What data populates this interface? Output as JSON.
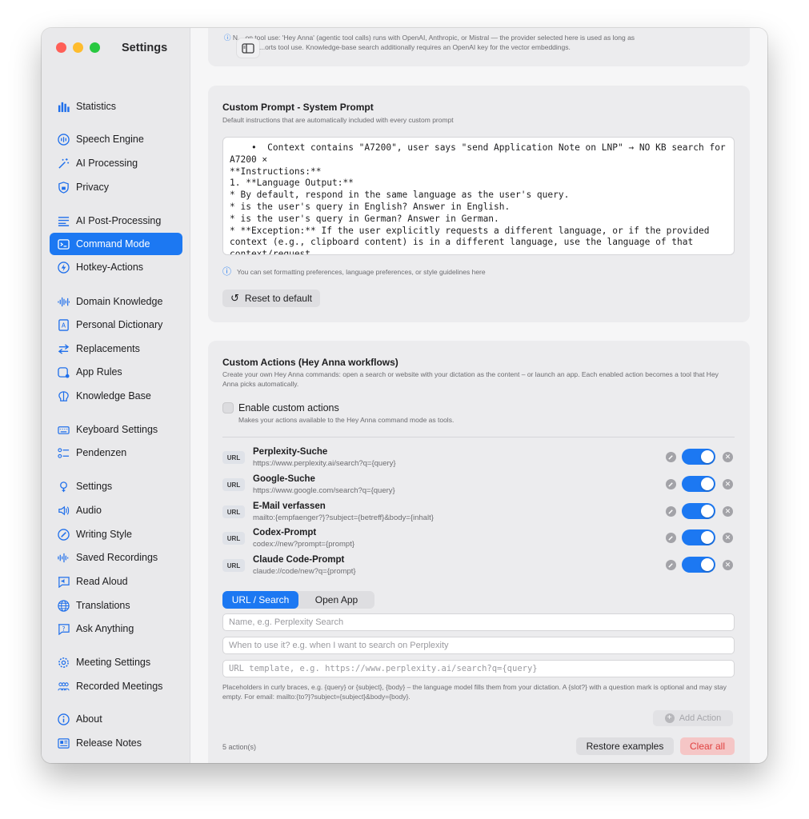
{
  "window": {
    "title": "Settings",
    "traffic_colors": [
      "#ff5f57",
      "#febc2e",
      "#28c840"
    ]
  },
  "sidebar": {
    "items": [
      {
        "label": "Statistics",
        "icon": "bar-chart-icon"
      },
      {
        "label": "Speech Engine",
        "icon": "waveform-circle-icon"
      },
      {
        "label": "AI Processing",
        "icon": "magic-wand-icon"
      },
      {
        "label": "Privacy",
        "icon": "lock-shield-icon"
      },
      {
        "label": "AI Post-Processing",
        "icon": "list-lines-icon"
      },
      {
        "label": "Command Mode",
        "icon": "terminal-icon"
      },
      {
        "label": "Hotkey-Actions",
        "icon": "bolt-circle-icon"
      },
      {
        "label": "Domain Knowledge",
        "icon": "waveform-icon"
      },
      {
        "label": "Personal Dictionary",
        "icon": "dictionary-icon"
      },
      {
        "label": "Replacements",
        "icon": "swap-arrows-icon"
      },
      {
        "label": "App Rules",
        "icon": "app-window-icon"
      },
      {
        "label": "Knowledge Base",
        "icon": "brain-icon"
      },
      {
        "label": "Keyboard Settings",
        "icon": "keyboard-icon"
      },
      {
        "label": "Pendenzen",
        "icon": "checklist-icon"
      },
      {
        "label": "Settings",
        "icon": "gear-icon"
      },
      {
        "label": "Audio",
        "icon": "speaker-icon"
      },
      {
        "label": "Writing Style",
        "icon": "pen-circle-icon"
      },
      {
        "label": "Saved Recordings",
        "icon": "recordings-icon"
      },
      {
        "label": "Read Aloud",
        "icon": "read-aloud-icon"
      },
      {
        "label": "Translations",
        "icon": "globe-icon"
      },
      {
        "label": "Ask Anything",
        "icon": "question-bubble-icon"
      },
      {
        "label": "Meeting Settings",
        "icon": "gear-small-icon"
      },
      {
        "label": "Recorded Meetings",
        "icon": "people-icon"
      },
      {
        "label": "About",
        "icon": "info-icon"
      },
      {
        "label": "Release Notes",
        "icon": "newspaper-icon"
      }
    ],
    "active": "Command Mode"
  },
  "top_info": {
    "line1": "N... on tool use: 'Hey Anna' (agentic tool calls) runs with OpenAI, Anthropic, or Mistral — the provider selected here is used as long as",
    "line2": "...orts tool use. Knowledge-base search additionally requires an OpenAI key for the vector embeddings."
  },
  "custom_prompt": {
    "title": "Custom Prompt - System Prompt",
    "subtitle": "Default instructions that are automatically included with every custom prompt",
    "text": "    •  Context contains \"A7200\", user says \"send Application Note on LNP\" → NO KB search for A7200 ×\n**Instructions:**\n1. **Language Output:**\n* By default, respond in the same language as the user's query.\n* is the user's query in English? Answer in English.\n* is the user's query in German? Answer in German.\n* **Exception:** If the user explicitly requests a different language, or if the provided context (e.g., clipboard content) is in a different language, use the language of that context/request.",
    "hint": "You can set formatting preferences, language preferences, or style guidelines here",
    "reset_label": "Reset to default"
  },
  "custom_actions": {
    "title": "Custom Actions (Hey Anna workflows)",
    "subtitle": "Create your own Hey Anna commands: open a search or website with your dictation as the content – or launch an app. Each enabled action becomes a tool that Hey Anna picks automatically.",
    "enable_label": "Enable custom actions",
    "enable_desc": "Makes your actions available to the Hey Anna command mode as tools.",
    "enabled": false,
    "badge": "URL",
    "actions": [
      {
        "name": "Perplexity-Suche",
        "url": "https://www.perplexity.ai/search?q={query}",
        "enabled": true
      },
      {
        "name": "Google-Suche",
        "url": "https://www.google.com/search?q={query}",
        "enabled": true
      },
      {
        "name": "E-Mail verfassen",
        "url": "mailto:{empfaenger?}?subject={betreff}&body={inhalt}",
        "enabled": true
      },
      {
        "name": "Codex-Prompt",
        "url": "codex://new?prompt={prompt}",
        "enabled": true
      },
      {
        "name": "Claude Code-Prompt",
        "url": "claude://code/new?q={prompt}",
        "enabled": true
      }
    ],
    "tabs": [
      "URL / Search",
      "Open App"
    ],
    "active_tab": "URL / Search",
    "name_placeholder": "Name, e.g. Perplexity Search",
    "when_placeholder": "When to use it? e.g. when I want to search on Perplexity",
    "url_placeholder": "URL template, e.g. https://www.perplexity.ai/search?q={query}",
    "placeholder_help": "Placeholders in curly braces, e.g. {query} or {subject}, {body} – the language model fills them from your dictation. A {slot?} with a question mark is optional and may stay empty. For email: mailto:{to?}?subject={subject}&body={body}.",
    "add_label": "Add Action",
    "count_label": "5 action(s)",
    "restore_label": "Restore examples",
    "clear_label": "Clear all"
  },
  "colors": {
    "accent": "#1c78f2",
    "danger": "#e0403f"
  }
}
